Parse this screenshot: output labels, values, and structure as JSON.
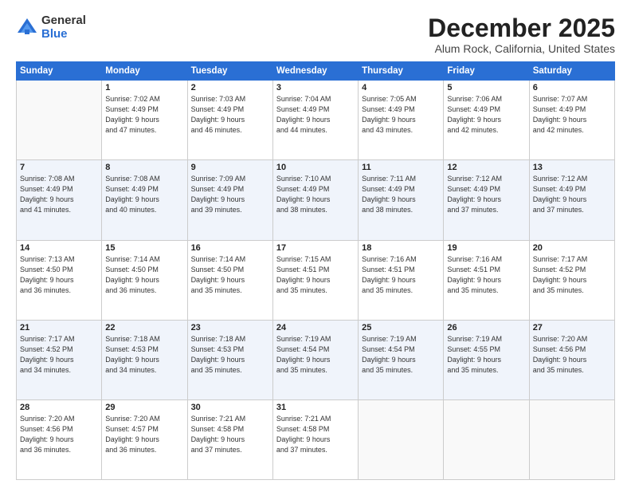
{
  "logo": {
    "general": "General",
    "blue": "Blue"
  },
  "title": "December 2025",
  "location": "Alum Rock, California, United States",
  "days_header": [
    "Sunday",
    "Monday",
    "Tuesday",
    "Wednesday",
    "Thursday",
    "Friday",
    "Saturday"
  ],
  "weeks": [
    [
      {
        "day": "",
        "info": ""
      },
      {
        "day": "1",
        "info": "Sunrise: 7:02 AM\nSunset: 4:49 PM\nDaylight: 9 hours\nand 47 minutes."
      },
      {
        "day": "2",
        "info": "Sunrise: 7:03 AM\nSunset: 4:49 PM\nDaylight: 9 hours\nand 46 minutes."
      },
      {
        "day": "3",
        "info": "Sunrise: 7:04 AM\nSunset: 4:49 PM\nDaylight: 9 hours\nand 44 minutes."
      },
      {
        "day": "4",
        "info": "Sunrise: 7:05 AM\nSunset: 4:49 PM\nDaylight: 9 hours\nand 43 minutes."
      },
      {
        "day": "5",
        "info": "Sunrise: 7:06 AM\nSunset: 4:49 PM\nDaylight: 9 hours\nand 42 minutes."
      },
      {
        "day": "6",
        "info": "Sunrise: 7:07 AM\nSunset: 4:49 PM\nDaylight: 9 hours\nand 42 minutes."
      }
    ],
    [
      {
        "day": "7",
        "info": "Sunrise: 7:08 AM\nSunset: 4:49 PM\nDaylight: 9 hours\nand 41 minutes."
      },
      {
        "day": "8",
        "info": "Sunrise: 7:08 AM\nSunset: 4:49 PM\nDaylight: 9 hours\nand 40 minutes."
      },
      {
        "day": "9",
        "info": "Sunrise: 7:09 AM\nSunset: 4:49 PM\nDaylight: 9 hours\nand 39 minutes."
      },
      {
        "day": "10",
        "info": "Sunrise: 7:10 AM\nSunset: 4:49 PM\nDaylight: 9 hours\nand 38 minutes."
      },
      {
        "day": "11",
        "info": "Sunrise: 7:11 AM\nSunset: 4:49 PM\nDaylight: 9 hours\nand 38 minutes."
      },
      {
        "day": "12",
        "info": "Sunrise: 7:12 AM\nSunset: 4:49 PM\nDaylight: 9 hours\nand 37 minutes."
      },
      {
        "day": "13",
        "info": "Sunrise: 7:12 AM\nSunset: 4:49 PM\nDaylight: 9 hours\nand 37 minutes."
      }
    ],
    [
      {
        "day": "14",
        "info": "Sunrise: 7:13 AM\nSunset: 4:50 PM\nDaylight: 9 hours\nand 36 minutes."
      },
      {
        "day": "15",
        "info": "Sunrise: 7:14 AM\nSunset: 4:50 PM\nDaylight: 9 hours\nand 36 minutes."
      },
      {
        "day": "16",
        "info": "Sunrise: 7:14 AM\nSunset: 4:50 PM\nDaylight: 9 hours\nand 35 minutes."
      },
      {
        "day": "17",
        "info": "Sunrise: 7:15 AM\nSunset: 4:51 PM\nDaylight: 9 hours\nand 35 minutes."
      },
      {
        "day": "18",
        "info": "Sunrise: 7:16 AM\nSunset: 4:51 PM\nDaylight: 9 hours\nand 35 minutes."
      },
      {
        "day": "19",
        "info": "Sunrise: 7:16 AM\nSunset: 4:51 PM\nDaylight: 9 hours\nand 35 minutes."
      },
      {
        "day": "20",
        "info": "Sunrise: 7:17 AM\nSunset: 4:52 PM\nDaylight: 9 hours\nand 35 minutes."
      }
    ],
    [
      {
        "day": "21",
        "info": "Sunrise: 7:17 AM\nSunset: 4:52 PM\nDaylight: 9 hours\nand 34 minutes."
      },
      {
        "day": "22",
        "info": "Sunrise: 7:18 AM\nSunset: 4:53 PM\nDaylight: 9 hours\nand 34 minutes."
      },
      {
        "day": "23",
        "info": "Sunrise: 7:18 AM\nSunset: 4:53 PM\nDaylight: 9 hours\nand 35 minutes."
      },
      {
        "day": "24",
        "info": "Sunrise: 7:19 AM\nSunset: 4:54 PM\nDaylight: 9 hours\nand 35 minutes."
      },
      {
        "day": "25",
        "info": "Sunrise: 7:19 AM\nSunset: 4:54 PM\nDaylight: 9 hours\nand 35 minutes."
      },
      {
        "day": "26",
        "info": "Sunrise: 7:19 AM\nSunset: 4:55 PM\nDaylight: 9 hours\nand 35 minutes."
      },
      {
        "day": "27",
        "info": "Sunrise: 7:20 AM\nSunset: 4:56 PM\nDaylight: 9 hours\nand 35 minutes."
      }
    ],
    [
      {
        "day": "28",
        "info": "Sunrise: 7:20 AM\nSunset: 4:56 PM\nDaylight: 9 hours\nand 36 minutes."
      },
      {
        "day": "29",
        "info": "Sunrise: 7:20 AM\nSunset: 4:57 PM\nDaylight: 9 hours\nand 36 minutes."
      },
      {
        "day": "30",
        "info": "Sunrise: 7:21 AM\nSunset: 4:58 PM\nDaylight: 9 hours\nand 37 minutes."
      },
      {
        "day": "31",
        "info": "Sunrise: 7:21 AM\nSunset: 4:58 PM\nDaylight: 9 hours\nand 37 minutes."
      },
      {
        "day": "",
        "info": ""
      },
      {
        "day": "",
        "info": ""
      },
      {
        "day": "",
        "info": ""
      }
    ]
  ]
}
